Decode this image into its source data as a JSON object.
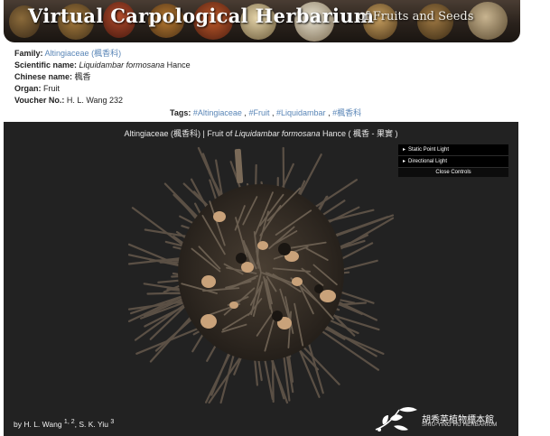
{
  "banner": {
    "title": "Virtual Carpological Herbarium",
    "subtitle": "of Fruits and Seeds"
  },
  "specimen": {
    "family_label": "Family:",
    "family_value": "Altingiaceae (楓香科)",
    "scientific_label": "Scientific name:",
    "scientific_genus_species": "Liquidambar formosana",
    "scientific_author": "Hance",
    "chinese_label": "Chinese name:",
    "chinese_value": "楓香",
    "organ_label": "Organ:",
    "organ_value": "Fruit",
    "voucher_label": "Voucher No.:",
    "voucher_value": "H. L. Wang 232"
  },
  "tags": {
    "label": "Tags:",
    "items": [
      "#Altingiaceae",
      "#Fruit",
      "#Liquidambar",
      "#楓香科"
    ],
    "separator": ","
  },
  "viewer": {
    "title_prefix": "Altingiaceae (楓香科) | Fruit of",
    "title_species": "Liquidambar formosana",
    "title_suffix": "Hance ( 楓香 - 果實 )",
    "controls": {
      "static_point_light": "Static Point Light",
      "directional_light": "Directional Light",
      "close": "Close Controls",
      "arrow_glyph": "▸"
    },
    "credit": {
      "by": "by H. L. Wang",
      "sup1": "1, 2",
      "comma": ",",
      "second_author": "S. K. Yiu",
      "sup2": "3"
    },
    "logo": {
      "cn": "胡秀英植物標本館",
      "en": "SHIU-YING HU HERBARIUM",
      "icon": "orchid-logo-icon"
    },
    "fruit_icon": "sweetgum-fruit-icon"
  },
  "colors": {
    "link": "#5a86b7",
    "viewer_bg": "#222222",
    "banner_bg": "#2a221c"
  }
}
